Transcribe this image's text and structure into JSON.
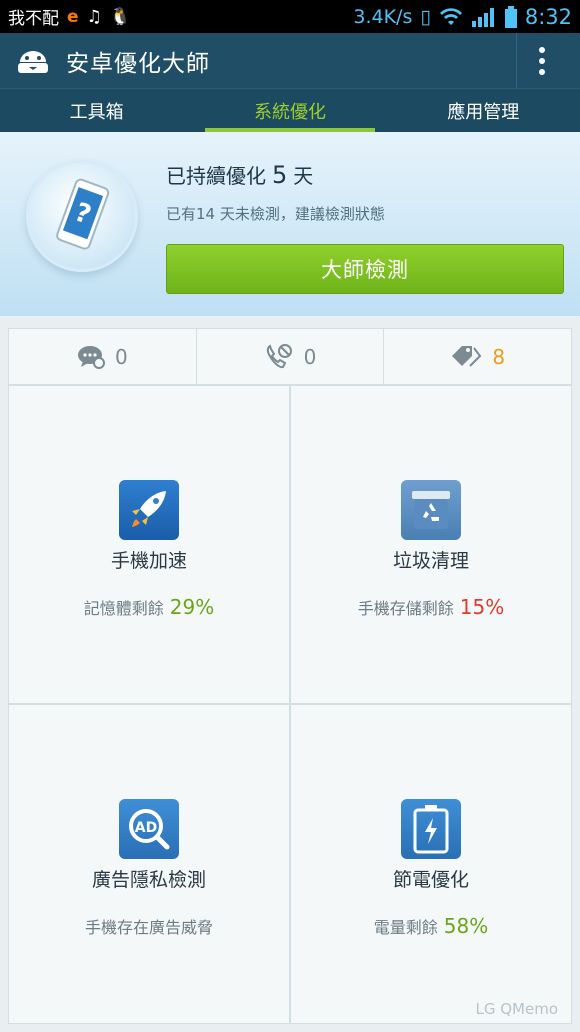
{
  "status_bar": {
    "left_text": "我不配",
    "net_speed": "3.4K/s",
    "time": "8:32"
  },
  "app": {
    "title": "安卓優化大師"
  },
  "tabs": [
    {
      "label": "工具箱"
    },
    {
      "label": "系統優化"
    },
    {
      "label": "應用管理"
    }
  ],
  "hero": {
    "title_prefix": "已持續優化",
    "days": "5",
    "title_suffix": "天",
    "subtitle": "已有14 天未檢測，建議檢測狀態",
    "button": "大師檢測"
  },
  "stats": [
    {
      "icon": "sms-blocked-icon",
      "count": "0"
    },
    {
      "icon": "call-blocked-icon",
      "count": "0"
    },
    {
      "icon": "tag-icon",
      "count": "8"
    }
  ],
  "tiles": [
    {
      "name": "手機加速",
      "desc": "記憶體剩餘",
      "value": "29%",
      "icon": "rocket-icon",
      "accent": "#6aa616"
    },
    {
      "name": "垃圾清理",
      "desc": "手機存儲剩餘",
      "value": "15%",
      "icon": "recycle-icon",
      "accent": "#e23b2d"
    },
    {
      "name": "廣告隱私檢測",
      "desc": "手機存在廣告威脅",
      "value": "",
      "icon": "ad-search-icon",
      "accent": ""
    },
    {
      "name": "節電優化",
      "desc": "電量剩餘",
      "value": "58%",
      "icon": "battery-icon",
      "accent": "#6aa616"
    }
  ],
  "watermark": "LG QMemo"
}
